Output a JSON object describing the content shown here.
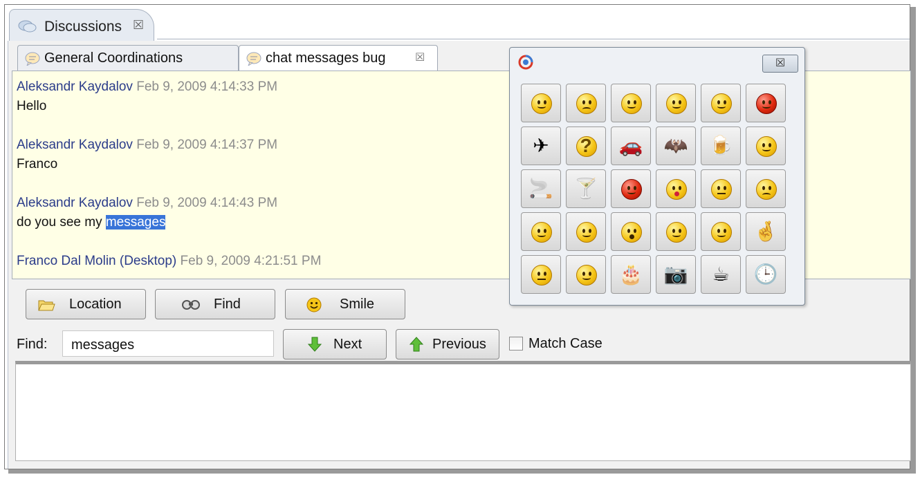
{
  "view": {
    "title": "Discussions",
    "close_glyph": "☒"
  },
  "tabs": [
    {
      "label": "General Coordinations",
      "active": false
    },
    {
      "label": "chat messages bug",
      "active": true,
      "close_glyph": "☒"
    }
  ],
  "messages": [
    {
      "author": "Aleksandr Kaydalov",
      "date": "Feb 9, 2009 4:14:33 PM",
      "text": "Hello"
    },
    {
      "author": "Aleksandr Kaydalov",
      "date": "Feb 9, 2009 4:14:37 PM",
      "text": "Franco"
    },
    {
      "author": "Aleksandr Kaydalov",
      "date": "Feb 9, 2009 4:14:43 PM",
      "text_before": "do you see my ",
      "highlight": "messages"
    },
    {
      "author": "Franco Dal Molin (Desktop)",
      "date": "Feb 9, 2009 4:21:51 PM",
      "text": ""
    }
  ],
  "toolbar": {
    "location": "Location",
    "find": "Find",
    "smile": "Smile"
  },
  "find_bar": {
    "label": "Find:",
    "value": "messages",
    "next": "Next",
    "previous": "Previous",
    "match_case": "Match Case",
    "match_case_checked": false
  },
  "popup": {
    "close_glyph": "☒",
    "emoticons": [
      [
        "smile-icon",
        "sad-icon",
        "wink-icon",
        "cool-glasses-icon",
        "thinking-icon",
        "angry-icon"
      ],
      [
        "airplane-icon",
        "question-icon",
        "car-icon",
        "bat-icon",
        "beer-icon",
        "rushing-icon"
      ],
      [
        "cigarette-icon",
        "cocktail-icon",
        "devil-icon",
        "kiss-icon",
        "neutral-icon",
        "crying-icon"
      ],
      [
        "blush-icon",
        "grin-icon",
        "surprised-icon",
        "tongue-icon",
        "nerd-icon",
        "fingers-crossed-icon"
      ],
      [
        "shy-icon",
        "laughing-icon",
        "cake-icon",
        "camera-icon",
        "coffee-icon",
        "clock-icon"
      ]
    ]
  }
}
